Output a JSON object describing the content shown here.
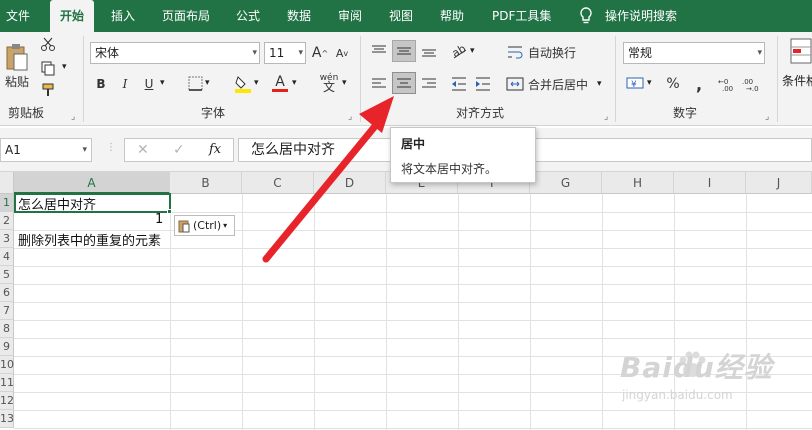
{
  "tabs": [
    "文件",
    "开始",
    "插入",
    "页面布局",
    "公式",
    "数据",
    "审阅",
    "视图",
    "帮助",
    "PDF工具集",
    "操作说明搜索"
  ],
  "ribbon": {
    "clipboard": {
      "paste_label": "粘贴",
      "group_label": "剪贴板"
    },
    "font": {
      "name": "宋体",
      "size": "11",
      "bold": "B",
      "italic": "I",
      "underline": "U",
      "size_up": "A",
      "size_down": "A",
      "phonetic": "wén",
      "group_label": "字体"
    },
    "alignment": {
      "wrap_label": "自动换行",
      "merge_label": "合并后居中",
      "group_label": "对齐方式"
    },
    "number": {
      "format": "常规",
      "currency": "¥",
      "percent": "%",
      "comma": ",",
      "group_label": "数字"
    },
    "styles": {
      "conditional_label": "条件格"
    }
  },
  "formula_bar": {
    "name_box": "A1",
    "fx": "fx",
    "content": "怎么居中对齐"
  },
  "tooltip": {
    "title": "居中",
    "description": "将文本居中对齐。"
  },
  "grid": {
    "columns": [
      "A",
      "B",
      "C",
      "D",
      "E",
      "F",
      "G",
      "H",
      "I",
      "J"
    ],
    "rows": [
      "1",
      "2",
      "3",
      "4",
      "5",
      "6",
      "7",
      "8",
      "9",
      "10",
      "11",
      "12",
      "13"
    ],
    "cells": {
      "a1": "怎么居中对齐",
      "a2": "1",
      "a3": "删除列表中的重复的元素"
    },
    "paste_options": "(Ctrl)"
  },
  "watermark": {
    "brand": "Baidu经验",
    "url": "jingyan.baidu.com"
  },
  "colors": {
    "accent": "#217346",
    "arrow": "#e8242b",
    "font_color": "#e2231a",
    "highlight": "#ffe600"
  }
}
